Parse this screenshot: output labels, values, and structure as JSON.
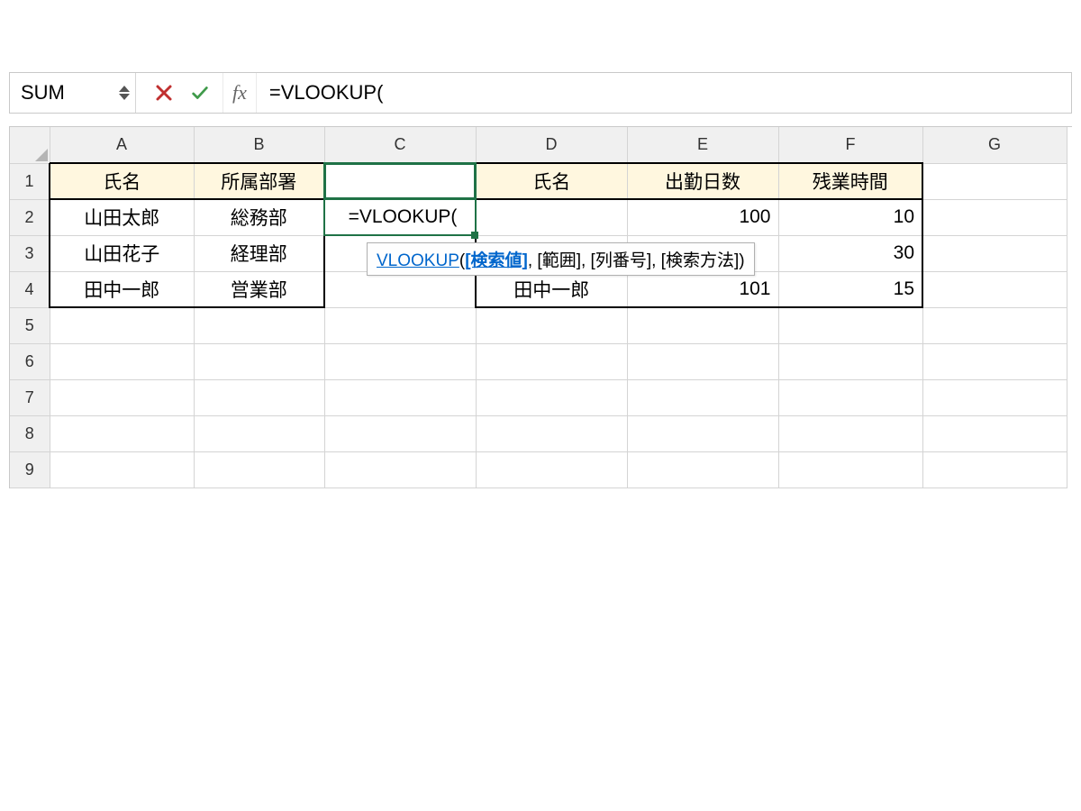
{
  "formula_bar": {
    "name_box": "SUM",
    "fx_label": "fx",
    "formula": "=VLOOKUP("
  },
  "columns": [
    "A",
    "B",
    "C",
    "D",
    "E",
    "F",
    "G"
  ],
  "rows": [
    "1",
    "2",
    "3",
    "4",
    "5",
    "6",
    "7",
    "8",
    "9"
  ],
  "headers_left": {
    "A1": "氏名",
    "B1": "所属部署"
  },
  "headers_right": {
    "D1": "氏名",
    "E1": "出勤日数",
    "F1": "残業時間"
  },
  "data_left": {
    "A2": "山田太郎",
    "B2": "総務部",
    "A3": "山田花子",
    "B3": "経理部",
    "A4": "田中一郎",
    "B4": "営業部"
  },
  "data_right": {
    "E2": "100",
    "F2": "10",
    "F3": "30",
    "D4": "田中一郎",
    "E4": "101",
    "F4": "15"
  },
  "editing": {
    "cell": "C2",
    "text": "=VLOOKUP("
  },
  "tooltip": {
    "fn": "VLOOKUP",
    "open": "(",
    "arg1": "[検索値]",
    "sep": ", ",
    "arg2": "[範囲]",
    "arg3": "[列番号]",
    "arg4": "[検索方法]",
    "close": ")"
  }
}
